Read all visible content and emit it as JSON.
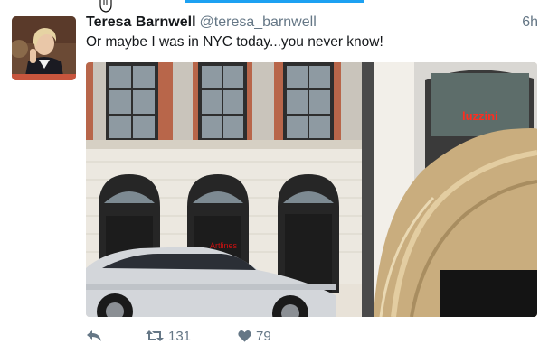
{
  "tweet": {
    "author_name": "Teresa Barnwell",
    "author_handle": "@teresa_barnwell",
    "timestamp": "6h",
    "text": "Or maybe I was in NYC today...you never know!",
    "media": {
      "signs": [
        {
          "text": "luzzini",
          "color": "#ff2d20"
        },
        {
          "text": "Artlines",
          "color": "#cc1010"
        }
      ]
    },
    "actions": {
      "reply_icon": "reply-icon",
      "retweet_icon": "retweet-icon",
      "retweet_count": "131",
      "like_icon": "heart-icon",
      "like_count": "79"
    }
  },
  "colors": {
    "accent": "#1da1f2",
    "text": "#14171a",
    "secondary_text": "#657786"
  }
}
